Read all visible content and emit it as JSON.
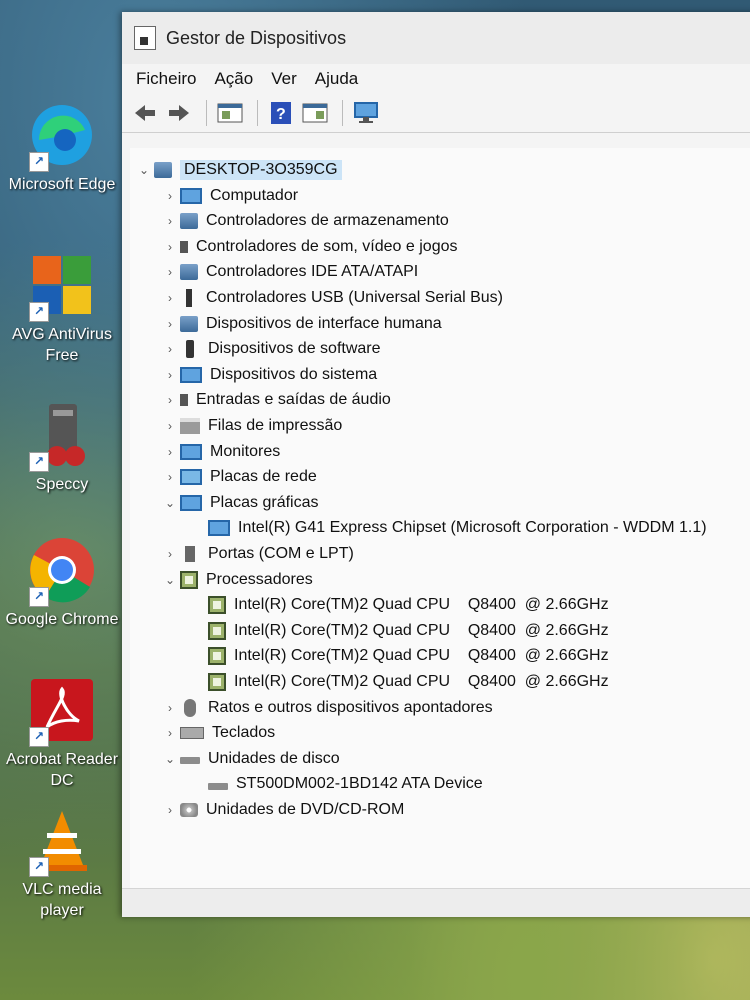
{
  "desktop": {
    "icons": [
      {
        "label": "Microsoft Edge",
        "icon": "edge-icon",
        "color": "#1fa0e0"
      },
      {
        "label": "AVG AntiVirus Free",
        "icon": "avg-icon",
        "color": "#e8641b"
      },
      {
        "label": "Speccy",
        "icon": "speccy-icon",
        "color": "#555555"
      },
      {
        "label": "Google Chrome",
        "icon": "chrome-icon",
        "color": "#db4437"
      },
      {
        "label": "Acrobat Reader DC",
        "icon": "acrobat-icon",
        "color": "#c8161d"
      },
      {
        "label": "VLC media player",
        "icon": "vlc-icon",
        "color": "#f28c00"
      }
    ]
  },
  "window": {
    "title": "Gestor de Dispositivos",
    "menu": [
      "Ficheiro",
      "Ação",
      "Ver",
      "Ajuda"
    ],
    "toolbar": [
      "back-arrow-icon",
      "forward-arrow-icon",
      "properties-icon",
      "help-icon",
      "update-driver-icon",
      "scan-hardware-icon"
    ]
  },
  "tree": {
    "root": "DESKTOP-3O359CG",
    "items": [
      {
        "label": "Computador",
        "expanded": false,
        "icon": "monitor"
      },
      {
        "label": "Controladores de armazenamento",
        "expanded": false,
        "icon": "generic"
      },
      {
        "label": "Controladores de som, vídeo e jogos",
        "expanded": false,
        "icon": "speaker"
      },
      {
        "label": "Controladores IDE ATA/ATAPI",
        "expanded": false,
        "icon": "generic"
      },
      {
        "label": "Controladores USB (Universal Serial Bus)",
        "expanded": false,
        "icon": "usb"
      },
      {
        "label": "Dispositivos de interface humana",
        "expanded": false,
        "icon": "generic"
      },
      {
        "label": "Dispositivos de software",
        "expanded": false,
        "icon": "phone"
      },
      {
        "label": "Dispositivos do sistema",
        "expanded": false,
        "icon": "monitor"
      },
      {
        "label": "Entradas e saídas de áudio",
        "expanded": false,
        "icon": "speaker"
      },
      {
        "label": "Filas de impressão",
        "expanded": false,
        "icon": "printer"
      },
      {
        "label": "Monitores",
        "expanded": false,
        "icon": "monitor"
      },
      {
        "label": "Placas de rede",
        "expanded": false,
        "icon": "network"
      },
      {
        "label": "Placas gráficas",
        "expanded": true,
        "icon": "monitor",
        "children": [
          "Intel(R) G41 Express Chipset (Microsoft Corporation - WDDM 1.1)"
        ],
        "child_icon": "monitor"
      },
      {
        "label": "Portas (COM e LPT)",
        "expanded": false,
        "icon": "port"
      },
      {
        "label": "Processadores",
        "expanded": true,
        "icon": "cpu",
        "children": [
          "Intel(R) Core(TM)2 Quad CPU    Q8400  @ 2.66GHz",
          "Intel(R) Core(TM)2 Quad CPU    Q8400  @ 2.66GHz",
          "Intel(R) Core(TM)2 Quad CPU    Q8400  @ 2.66GHz",
          "Intel(R) Core(TM)2 Quad CPU    Q8400  @ 2.66GHz"
        ],
        "child_icon": "cpu"
      },
      {
        "label": "Ratos e outros dispositivos apontadores",
        "expanded": false,
        "icon": "mouse"
      },
      {
        "label": "Teclados",
        "expanded": false,
        "icon": "keyboard"
      },
      {
        "label": "Unidades de disco",
        "expanded": true,
        "icon": "disk",
        "children": [
          "ST500DM002-1BD142 ATA Device"
        ],
        "child_icon": "disk"
      },
      {
        "label": "Unidades de DVD/CD-ROM",
        "expanded": false,
        "icon": "dvd"
      }
    ]
  }
}
